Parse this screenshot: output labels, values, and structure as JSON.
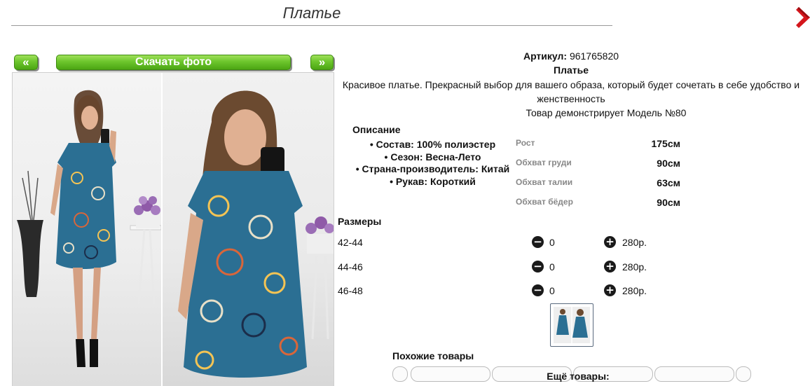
{
  "header": {
    "title": "Платье"
  },
  "gallery": {
    "prev_label": "«",
    "download_label": "Скачать фото",
    "next_label": "»"
  },
  "product": {
    "article_label": "Артикул:",
    "article_value": "961765820",
    "name": "Платье",
    "description": "Красивое платье. Прекрасный выбор для вашего образа, который будет сочетать в себе удобство и женственность",
    "model_line": "Товар демонстрирует Модель №80"
  },
  "description": {
    "heading": "Описание",
    "items": [
      "Состав: 100% полиэстер",
      "Сезон: Весна-Лето",
      "Страна-производитель: Китай",
      "Рукав: Короткий"
    ]
  },
  "measurements": [
    {
      "label": "Рост",
      "value": "175см"
    },
    {
      "label": "Обхват груди",
      "value": "90см"
    },
    {
      "label": "Обхват талии",
      "value": "63см"
    },
    {
      "label": "Обхват бёдер",
      "value": "90см"
    }
  ],
  "sizes": {
    "heading": "Размеры",
    "rows": [
      {
        "name": "42-44",
        "qty": "0",
        "price": "280р."
      },
      {
        "name": "44-46",
        "qty": "0",
        "price": "280р."
      },
      {
        "name": "46-48",
        "qty": "0",
        "price": "280р."
      }
    ]
  },
  "similar": {
    "heading": "Похожие товары"
  },
  "more": {
    "heading": "Ещё товары:"
  },
  "icons": {
    "close": "close-icon",
    "minus": "minus-circle-icon",
    "plus": "plus-circle-icon"
  },
  "colors": {
    "accent_green": "#6cc52c",
    "close_red": "#d4161c",
    "dress_blue": "#2b6f93"
  }
}
